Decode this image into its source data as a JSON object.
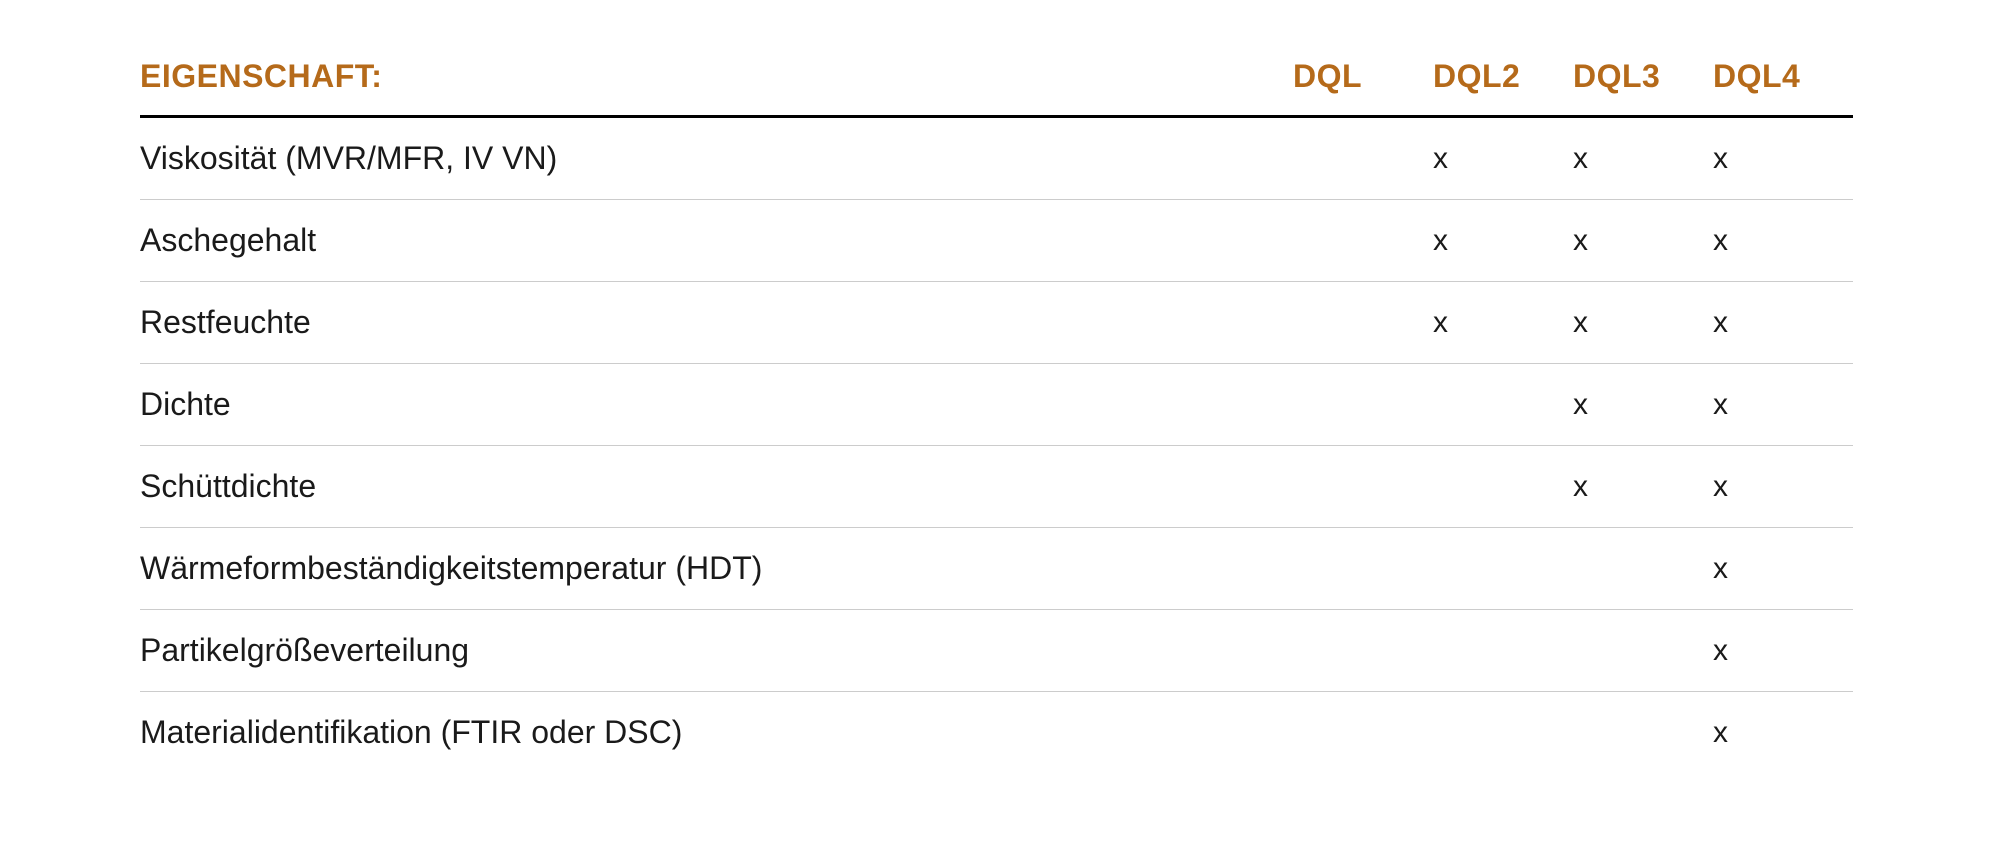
{
  "table": {
    "header": {
      "property": "EIGENSCHAFT:",
      "columns": [
        "DQL",
        "DQL2",
        "DQL3",
        "DQL4"
      ]
    },
    "rows": [
      {
        "property": "Viskosität (MVR/MFR, IV VN)",
        "values": [
          "",
          "x",
          "x",
          "x"
        ]
      },
      {
        "property": "Aschegehalt",
        "values": [
          "",
          "x",
          "x",
          "x"
        ]
      },
      {
        "property": "Restfeuchte",
        "values": [
          "",
          "x",
          "x",
          "x"
        ]
      },
      {
        "property": "Dichte",
        "values": [
          "",
          "",
          "x",
          "x"
        ]
      },
      {
        "property": "Schüttdichte",
        "values": [
          "",
          "",
          "x",
          "x"
        ]
      },
      {
        "property": "Wärmeformbeständigkeitstemperatur (HDT)",
        "values": [
          "",
          "",
          "",
          "x"
        ]
      },
      {
        "property": "Partikelgrößeverteilung",
        "values": [
          "",
          "",
          "",
          "x"
        ]
      },
      {
        "property": "Materialidentifikation (FTIR oder DSC)",
        "values": [
          "",
          "",
          "",
          "x"
        ]
      }
    ]
  }
}
